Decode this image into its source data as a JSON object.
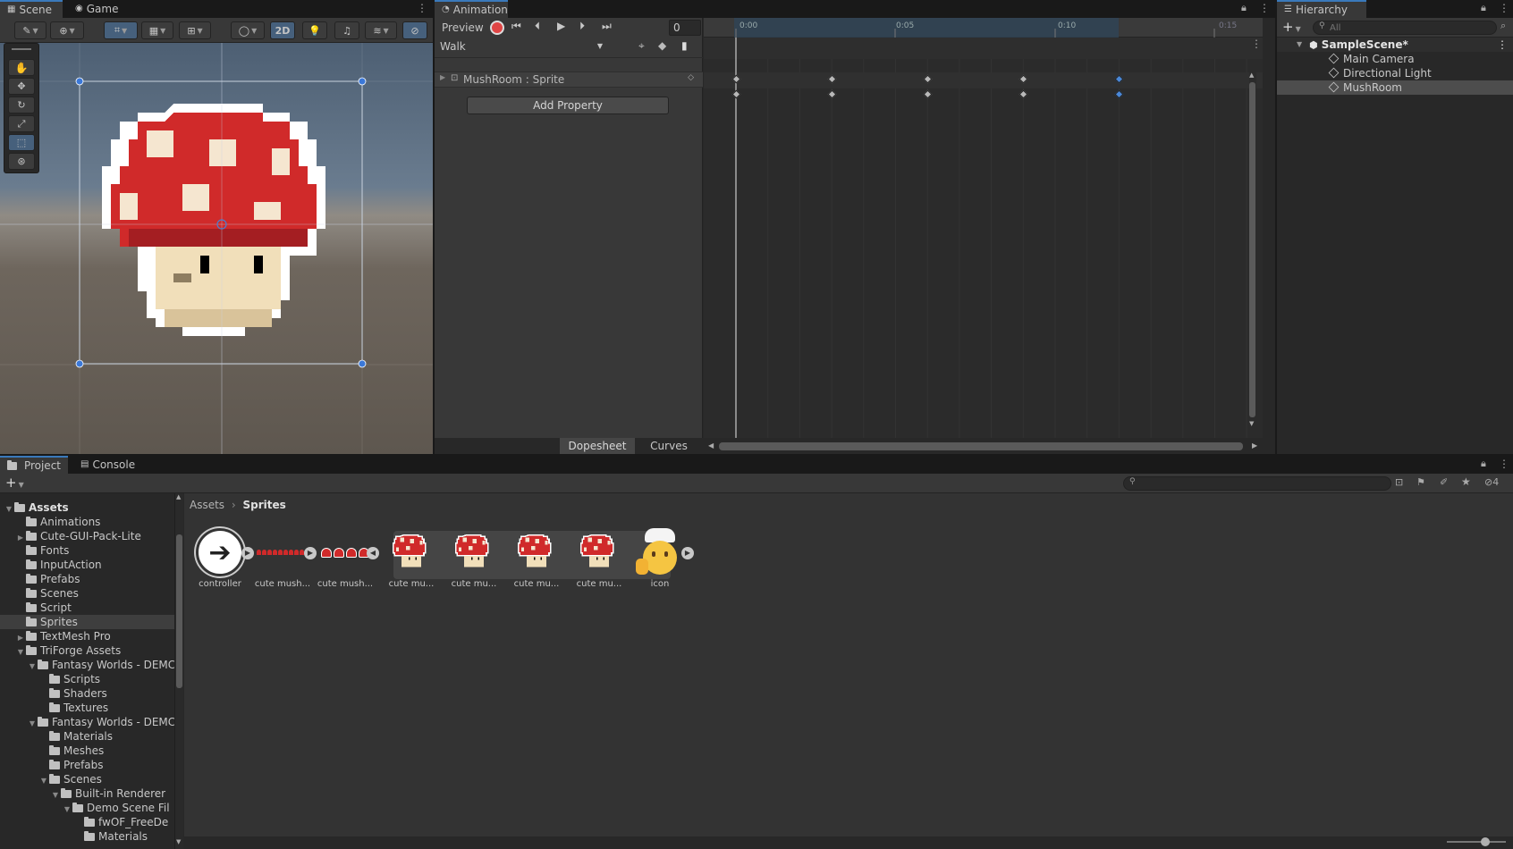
{
  "scene": {
    "tabs": [
      {
        "label": "Scene",
        "icon": "grid-icon"
      },
      {
        "label": "Game",
        "icon": "gamepad-icon"
      }
    ],
    "toolbar": {
      "mode_2d": "2D"
    },
    "tools": [
      "hand-tool",
      "move-tool",
      "rotate-tool",
      "scale-tool",
      "rect-tool",
      "transform-tool"
    ]
  },
  "animation": {
    "tab": "Animation",
    "preview": "Preview",
    "frame": "0",
    "clip": "Walk",
    "property": "MushRoom : Sprite",
    "add_property": "Add Property",
    "ruler": [
      "0:00",
      "0:05",
      "0:10",
      "0:15"
    ],
    "keyframes_seconds": [
      0,
      0.03,
      0.06,
      0.09,
      0.12
    ],
    "dopesheet": "Dopesheet",
    "curves": "Curves"
  },
  "hierarchy": {
    "tab": "Hierarchy",
    "search_placeholder": "All",
    "scene": "SampleScene*",
    "items": [
      "Main Camera",
      "Directional Light",
      "MushRoom"
    ]
  },
  "project": {
    "tabs": [
      "Project",
      "Console"
    ],
    "breadcrumb": [
      "Assets",
      "Sprites"
    ],
    "badge": "4",
    "tree": [
      {
        "label": "Assets",
        "depth": 0,
        "arrow": "open"
      },
      {
        "label": "Animations",
        "depth": 1,
        "arrow": ""
      },
      {
        "label": "Cute-GUI-Pack-Lite",
        "depth": 1,
        "arrow": "closed"
      },
      {
        "label": "Fonts",
        "depth": 1,
        "arrow": ""
      },
      {
        "label": "InputAction",
        "depth": 1,
        "arrow": ""
      },
      {
        "label": "Prefabs",
        "depth": 1,
        "arrow": ""
      },
      {
        "label": "Scenes",
        "depth": 1,
        "arrow": ""
      },
      {
        "label": "Script",
        "depth": 1,
        "arrow": ""
      },
      {
        "label": "Sprites",
        "depth": 1,
        "arrow": ""
      },
      {
        "label": "TextMesh Pro",
        "depth": 1,
        "arrow": "closed"
      },
      {
        "label": "TriForge Assets",
        "depth": 1,
        "arrow": "open"
      },
      {
        "label": "Fantasy Worlds - DEMC",
        "depth": 2,
        "arrow": "open"
      },
      {
        "label": "Scripts",
        "depth": 3,
        "arrow": ""
      },
      {
        "label": "Shaders",
        "depth": 3,
        "arrow": ""
      },
      {
        "label": "Textures",
        "depth": 3,
        "arrow": ""
      },
      {
        "label": "Fantasy Worlds - DEMC",
        "depth": 2,
        "arrow": "open"
      },
      {
        "label": "Materials",
        "depth": 3,
        "arrow": ""
      },
      {
        "label": "Meshes",
        "depth": 3,
        "arrow": ""
      },
      {
        "label": "Prefabs",
        "depth": 3,
        "arrow": ""
      },
      {
        "label": "Scenes",
        "depth": 3,
        "arrow": "open"
      },
      {
        "label": "Built-in Renderer",
        "depth": 4,
        "arrow": "open"
      },
      {
        "label": "Demo Scene Fil",
        "depth": 5,
        "arrow": "open"
      },
      {
        "label": "fwOF_FreeDe",
        "depth": 6,
        "arrow": ""
      },
      {
        "label": "Materials",
        "depth": 6,
        "arrow": ""
      }
    ],
    "assets": [
      {
        "label": "controller",
        "kind": "controller"
      },
      {
        "label": "cute mush...",
        "kind": "strip"
      },
      {
        "label": "cute mush...",
        "kind": "strip3"
      },
      {
        "label": "cute mu...",
        "kind": "mushroom"
      },
      {
        "label": "cute mu...",
        "kind": "mushroom"
      },
      {
        "label": "cute mu...",
        "kind": "mushroom"
      },
      {
        "label": "cute mu...",
        "kind": "mushroom"
      },
      {
        "label": "icon",
        "kind": "chef"
      }
    ]
  }
}
